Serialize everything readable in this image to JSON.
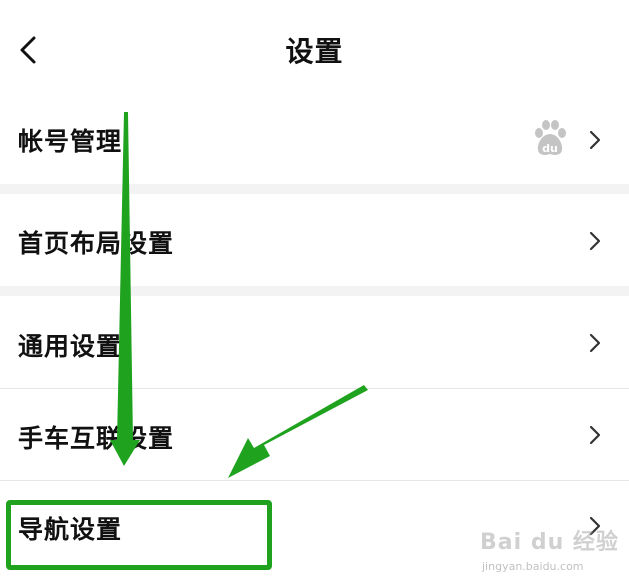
{
  "header": {
    "title": "设置",
    "back_icon": "chevron-left-icon"
  },
  "rows": [
    {
      "label": "帐号管理",
      "icon": "baidu-paw-icon"
    },
    {
      "label": "首页布局设置"
    },
    {
      "label": "通用设置"
    },
    {
      "label": "手车互联设置"
    },
    {
      "label": "导航设置"
    }
  ],
  "watermark": {
    "brand": "Bai du 经验",
    "url": "jingyan.baidu.com"
  },
  "colors": {
    "annotation_green": "#1fa31f",
    "section_gap": "#f3f3f3",
    "baidu_icon_gray": "#c4c4c4"
  }
}
